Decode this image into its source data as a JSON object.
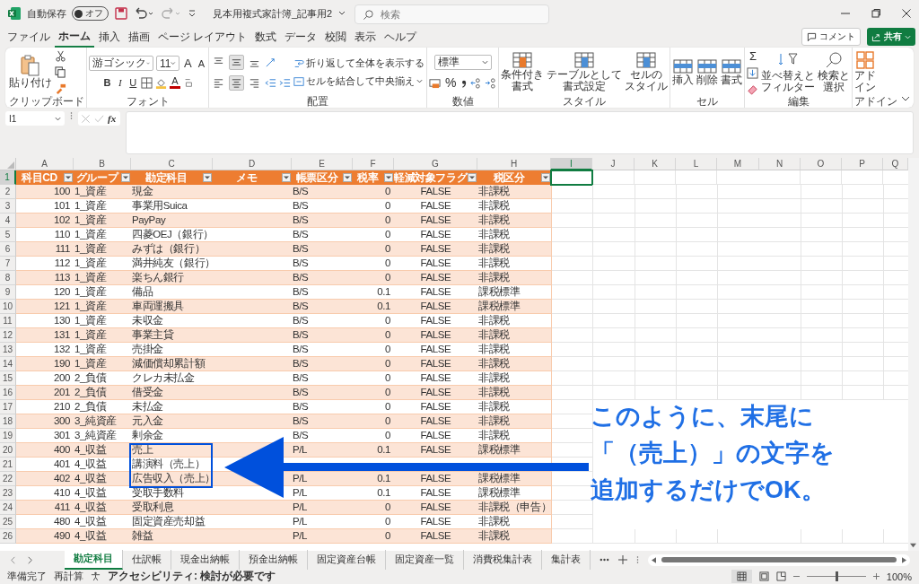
{
  "titlebar": {
    "autosave_label": "自動保存",
    "autosave_state": "オフ",
    "autosave_on": false,
    "title": "見本用複式家計簿_記事用2",
    "search_placeholder": "検索"
  },
  "menu_tabs": [
    {
      "label": "ファイル",
      "selected": false
    },
    {
      "label": "ホーム",
      "selected": true
    },
    {
      "label": "挿入",
      "selected": false
    },
    {
      "label": "描画",
      "selected": false
    },
    {
      "label": "ページ レイアウト",
      "selected": false
    },
    {
      "label": "数式",
      "selected": false
    },
    {
      "label": "データ",
      "selected": false
    },
    {
      "label": "校閲",
      "selected": false
    },
    {
      "label": "表示",
      "selected": false
    },
    {
      "label": "ヘルプ",
      "selected": false
    }
  ],
  "comment_button": "コメント",
  "share_button": "共有",
  "ribbon": {
    "clipboard": {
      "paste": "貼り付け",
      "label": "クリップボード"
    },
    "font": {
      "name": "游ゴシック",
      "size": "11",
      "grow": "A",
      "shrink": "A",
      "styles": [
        {
          "kind": "bold",
          "label": "B"
        },
        {
          "kind": "italic",
          "label": "I"
        },
        {
          "kind": "underline",
          "label": "U"
        }
      ],
      "color_letter": "A",
      "label": "フォント"
    },
    "alignment": {
      "vertical": [
        {
          "kind": "top",
          "selected": false
        },
        {
          "kind": "middle",
          "selected": true
        },
        {
          "kind": "bottom",
          "selected": false
        }
      ],
      "horizontal": [
        {
          "kind": "left",
          "selected": false
        },
        {
          "kind": "center",
          "selected": true
        },
        {
          "kind": "right",
          "selected": false
        }
      ],
      "wrap": "折り返して全体を表示する",
      "merge": "セルを結合して中央揃え",
      "label": "配置"
    },
    "number": {
      "format": "標準",
      "percent": "%",
      "label": "数値"
    },
    "styles": {
      "buttons": [
        [
          "条件付き",
          "書式"
        ],
        [
          "テーブルとして",
          "書式設定"
        ],
        [
          "セルの",
          "スタイル"
        ]
      ],
      "label": "スタイル"
    },
    "cells": {
      "buttons": [
        "挿入",
        "削除",
        "書式"
      ],
      "label": "セル"
    },
    "editing": {
      "sum": "Σ",
      "buttons": [
        [
          "並べ替えと",
          "フィルター"
        ],
        [
          "検索と",
          "選択"
        ]
      ],
      "label": "編集"
    },
    "addins": {
      "button": [
        "アド",
        "イン"
      ],
      "label": "アドイン"
    }
  },
  "formula_bar": {
    "name_box": "I1",
    "fx": "fx"
  },
  "grid": {
    "columns": [
      {
        "label": "A",
        "selected": false
      },
      {
        "label": "B",
        "selected": false
      },
      {
        "label": "C",
        "selected": false
      },
      {
        "label": "D",
        "selected": false
      },
      {
        "label": "E",
        "selected": false
      },
      {
        "label": "F",
        "selected": false
      },
      {
        "label": "G",
        "selected": false
      },
      {
        "label": "H",
        "selected": false
      },
      {
        "label": "I",
        "selected": true
      },
      {
        "label": "J",
        "selected": false
      },
      {
        "label": "K",
        "selected": false
      },
      {
        "label": "L",
        "selected": false
      },
      {
        "label": "M",
        "selected": false
      },
      {
        "label": "N",
        "selected": false
      },
      {
        "label": "O",
        "selected": false
      },
      {
        "label": "P",
        "selected": false
      },
      {
        "label": "Q",
        "selected": false
      }
    ],
    "header_row": {
      "num": "1",
      "selected": true,
      "titles": [
        "科目CD",
        "グループ",
        "勘定科目",
        "メモ",
        "帳票区分",
        "税率",
        "軽減対象フラグ",
        "税区分"
      ]
    },
    "rows": [
      {
        "num": "2",
        "selected": false,
        "cd": "100",
        "group": "1_資産",
        "account": "現金",
        "type": "B/S",
        "rate": "0",
        "flag": "FALSE",
        "tax": "非課税"
      },
      {
        "num": "3",
        "selected": false,
        "cd": "101",
        "group": "1_資産",
        "account": "事業用Suica",
        "type": "B/S",
        "rate": "0",
        "flag": "FALSE",
        "tax": "非課税"
      },
      {
        "num": "4",
        "selected": false,
        "cd": "102",
        "group": "1_資産",
        "account": "PayPay",
        "type": "B/S",
        "rate": "0",
        "flag": "FALSE",
        "tax": "非課税"
      },
      {
        "num": "5",
        "selected": false,
        "cd": "110",
        "group": "1_資産",
        "account": "四菱OEJ（銀行）",
        "type": "B/S",
        "rate": "0",
        "flag": "FALSE",
        "tax": "非課税"
      },
      {
        "num": "6",
        "selected": false,
        "cd": "111",
        "group": "1_資産",
        "account": "みずは（銀行）",
        "type": "B/S",
        "rate": "0",
        "flag": "FALSE",
        "tax": "非課税"
      },
      {
        "num": "7",
        "selected": false,
        "cd": "112",
        "group": "1_資産",
        "account": "満井純友（銀行）",
        "type": "B/S",
        "rate": "0",
        "flag": "FALSE",
        "tax": "非課税"
      },
      {
        "num": "8",
        "selected": false,
        "cd": "113",
        "group": "1_資産",
        "account": "楽ちん銀行",
        "type": "B/S",
        "rate": "0",
        "flag": "FALSE",
        "tax": "非課税"
      },
      {
        "num": "9",
        "selected": false,
        "cd": "120",
        "group": "1_資産",
        "account": "備品",
        "type": "B/S",
        "rate": "0.1",
        "flag": "FALSE",
        "tax": "課税標準"
      },
      {
        "num": "10",
        "selected": false,
        "cd": "121",
        "group": "1_資産",
        "account": "車両運搬具",
        "type": "B/S",
        "rate": "0.1",
        "flag": "FALSE",
        "tax": "課税標準"
      },
      {
        "num": "11",
        "selected": false,
        "cd": "130",
        "group": "1_資産",
        "account": "未収金",
        "type": "B/S",
        "rate": "0",
        "flag": "FALSE",
        "tax": "非課税"
      },
      {
        "num": "12",
        "selected": false,
        "cd": "131",
        "group": "1_資産",
        "account": "事業主貸",
        "type": "B/S",
        "rate": "0",
        "flag": "FALSE",
        "tax": "非課税"
      },
      {
        "num": "13",
        "selected": false,
        "cd": "132",
        "group": "1_資産",
        "account": "売掛金",
        "type": "B/S",
        "rate": "0",
        "flag": "FALSE",
        "tax": "非課税"
      },
      {
        "num": "14",
        "selected": false,
        "cd": "190",
        "group": "1_資産",
        "account": "減価償却累計額",
        "type": "B/S",
        "rate": "0",
        "flag": "FALSE",
        "tax": "非課税"
      },
      {
        "num": "15",
        "selected": false,
        "cd": "200",
        "group": "2_負債",
        "account": "クレカ未払金",
        "type": "B/S",
        "rate": "0",
        "flag": "FALSE",
        "tax": "非課税"
      },
      {
        "num": "16",
        "selected": false,
        "cd": "201",
        "group": "2_負債",
        "account": "借受金",
        "type": "B/S",
        "rate": "0",
        "flag": "FALSE",
        "tax": "非課税"
      },
      {
        "num": "17",
        "selected": false,
        "cd": "210",
        "group": "2_負債",
        "account": "未払金",
        "type": "B/S",
        "rate": "0",
        "flag": "FALSE",
        "tax": "非課税"
      },
      {
        "num": "18",
        "selected": false,
        "cd": "300",
        "group": "3_純資産",
        "account": "元入金",
        "type": "B/S",
        "rate": "0",
        "flag": "FALSE",
        "tax": "非課税"
      },
      {
        "num": "19",
        "selected": false,
        "cd": "301",
        "group": "3_純資産",
        "account": "剰余金",
        "type": "B/S",
        "rate": "0",
        "flag": "FALSE",
        "tax": "非課税"
      },
      {
        "num": "20",
        "selected": false,
        "cd": "400",
        "group": "4_収益",
        "account": "売上",
        "type": "P/L",
        "rate": "0.1",
        "flag": "FALSE",
        "tax": "課税標準"
      },
      {
        "num": "21",
        "selected": false,
        "cd": "401",
        "group": "4_収益",
        "account": "講演料（売上）"
      },
      {
        "num": "22",
        "selected": false,
        "cd": "402",
        "group": "4_収益",
        "account": "広告収入（売上）",
        "type": "P/L",
        "rate": "0.1",
        "flag": "FALSE",
        "tax": "課税標準"
      },
      {
        "num": "23",
        "selected": false,
        "cd": "410",
        "group": "4_収益",
        "account": "受取手数料",
        "type": "P/L",
        "rate": "0.1",
        "flag": "FALSE",
        "tax": "課税標準"
      },
      {
        "num": "24",
        "selected": false,
        "cd": "411",
        "group": "4_収益",
        "account": "受取利息",
        "type": "P/L",
        "rate": "0",
        "flag": "FALSE",
        "tax": "非課税（申告）"
      },
      {
        "num": "25",
        "selected": false,
        "cd": "480",
        "group": "4_収益",
        "account": "固定資産売却益",
        "type": "P/L",
        "rate": "0",
        "flag": "FALSE",
        "tax": "非課税"
      },
      {
        "num": "26",
        "selected": false,
        "cd": "490",
        "group": "4_収益",
        "account": "雑益",
        "type": "P/L",
        "rate": "0",
        "flag": "FALSE",
        "tax": "非課税"
      }
    ]
  },
  "callout": [
    "このように、末尾に",
    "「（売上）」の文字を",
    "追加するだけでOK。"
  ],
  "sheet_tabs": [
    {
      "label": "勘定科目",
      "selected": true
    },
    {
      "label": "仕訳帳",
      "selected": false
    },
    {
      "label": "現金出納帳",
      "selected": false
    },
    {
      "label": "預金出納帳",
      "selected": false
    },
    {
      "label": "固定資産台帳",
      "selected": false
    },
    {
      "label": "固定資産一覧",
      "selected": false
    },
    {
      "label": "消費税集計表",
      "selected": false
    },
    {
      "label": "集計表",
      "selected": false
    }
  ],
  "status_bar": {
    "ready": "準備完了",
    "recalc": "再計算",
    "accessibility": "アクセシビリティ: 検討が必要です",
    "zoom": {
      "level": 0.5,
      "reading": "100%"
    }
  }
}
